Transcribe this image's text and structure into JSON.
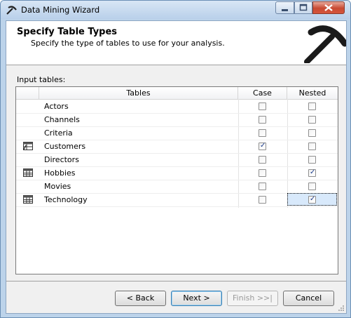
{
  "window": {
    "title": "Data Mining Wizard"
  },
  "header": {
    "title": "Specify Table Types",
    "subtitle": "Specify the type of tables to use for your analysis."
  },
  "input_tables_label": "Input tables:",
  "grid": {
    "columns": [
      "",
      "Tables",
      "Case",
      "Nested"
    ],
    "rows": [
      {
        "name": "Actors",
        "icon": "",
        "case": false,
        "nested": false
      },
      {
        "name": "Channels",
        "icon": "",
        "case": false,
        "nested": false
      },
      {
        "name": "Criteria",
        "icon": "",
        "case": false,
        "nested": false
      },
      {
        "name": "Customers",
        "icon": "case-table-icon",
        "case": true,
        "nested": false
      },
      {
        "name": "Directors",
        "icon": "",
        "case": false,
        "nested": false
      },
      {
        "name": "Hobbies",
        "icon": "nested-table-icon",
        "case": false,
        "nested": true
      },
      {
        "name": "Movies",
        "icon": "",
        "case": false,
        "nested": false
      },
      {
        "name": "Technology",
        "icon": "nested-table-icon",
        "case": false,
        "nested": true
      }
    ]
  },
  "buttons": {
    "back": "< Back",
    "next": "Next >",
    "finish": "Finish >>|",
    "cancel": "Cancel"
  }
}
